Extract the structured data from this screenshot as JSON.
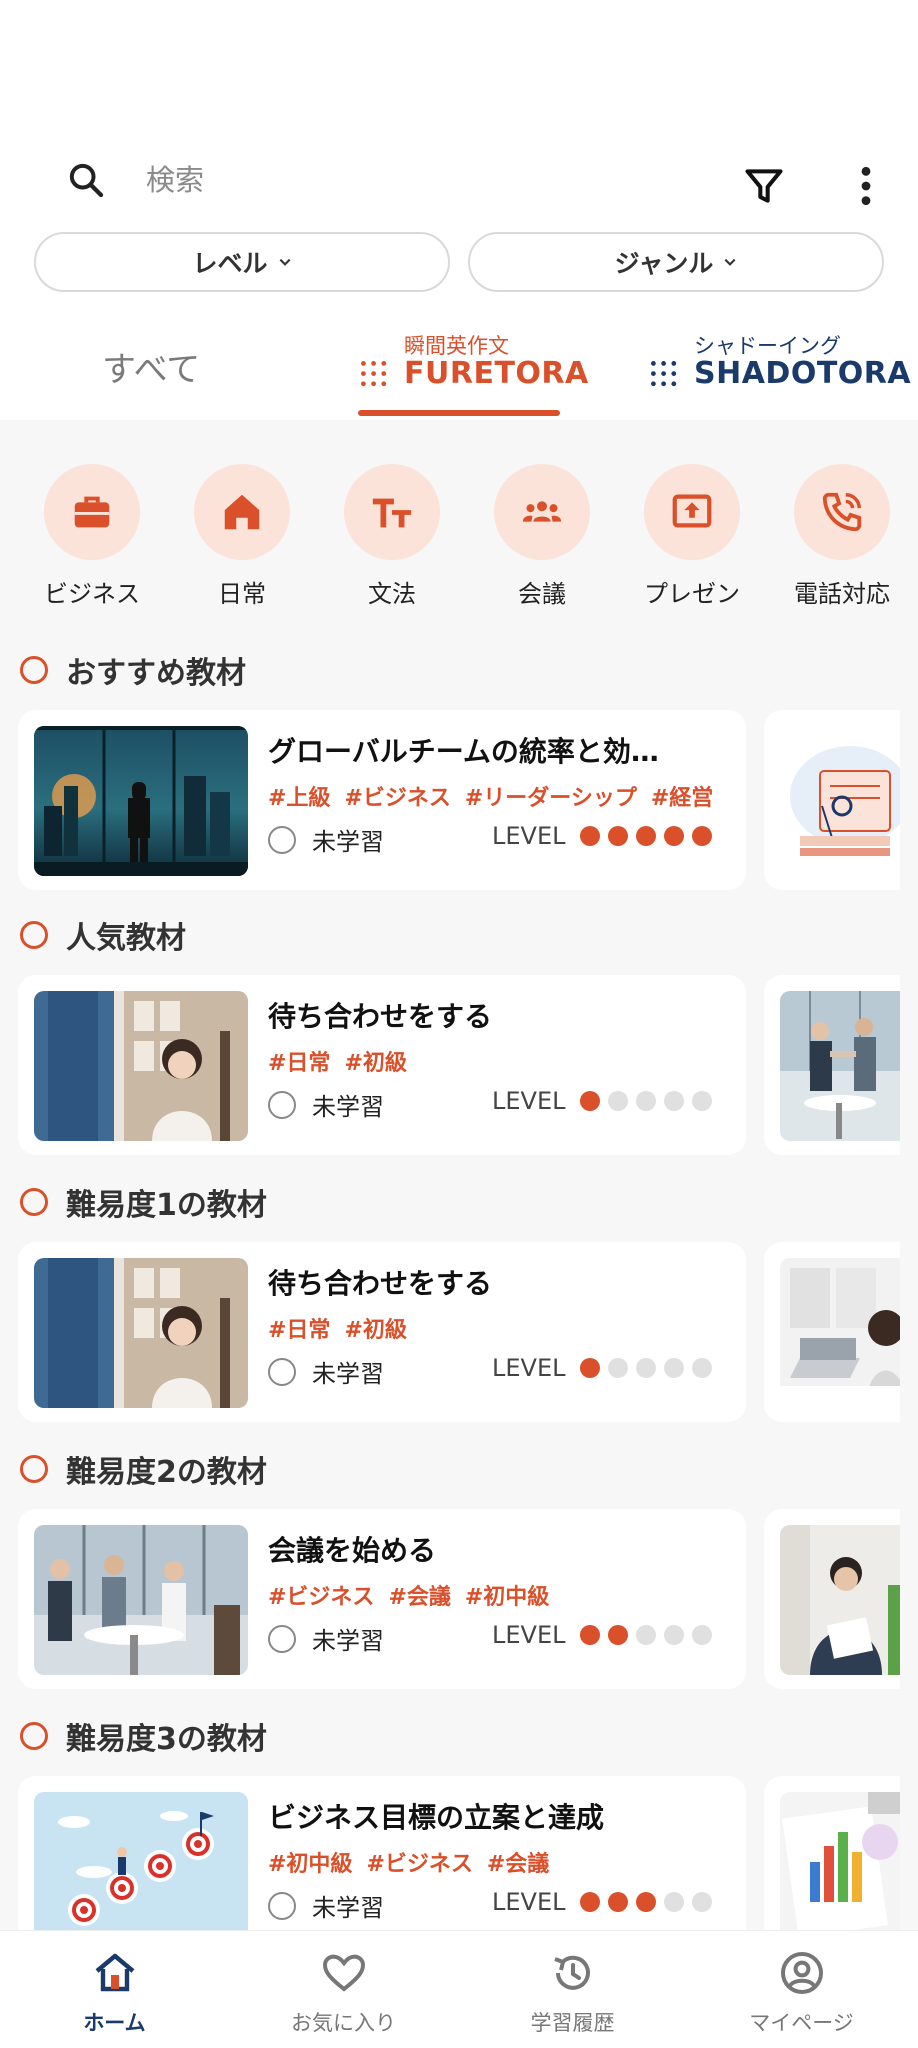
{
  "search": {
    "placeholder": "検索"
  },
  "filters": {
    "level_label": "レベル",
    "genre_label": "ジャンル"
  },
  "tabs": {
    "all_label": "すべて",
    "furetora": {
      "sub": "瞬間英作文",
      "main": "FURETORA"
    },
    "shadotora": {
      "sub": "シャドーイング",
      "main": "SHADOTORA"
    }
  },
  "categories": [
    {
      "label": "ビジネス",
      "icon": "briefcase-icon"
    },
    {
      "label": "日常",
      "icon": "home-icon"
    },
    {
      "label": "文法",
      "icon": "text-size-icon"
    },
    {
      "label": "会議",
      "icon": "group-icon"
    },
    {
      "label": "プレゼン",
      "icon": "presentation-icon"
    },
    {
      "label": "電話対応",
      "icon": "phone-icon"
    }
  ],
  "sections": [
    {
      "title": "おすすめ教材",
      "card": {
        "title": "グローバルチームの統率と効…",
        "tags": [
          "#上級",
          "#ビジネス",
          "#リーダーシップ",
          "#経営"
        ],
        "status": "未学習",
        "level_label": "LEVEL",
        "level": 5
      }
    },
    {
      "title": "人気教材",
      "card": {
        "title": "待ち合わせをする",
        "tags": [
          "#日常",
          "#初級"
        ],
        "status": "未学習",
        "level_label": "LEVEL",
        "level": 1
      }
    },
    {
      "title": "難易度1の教材",
      "card": {
        "title": "待ち合わせをする",
        "tags": [
          "#日常",
          "#初級"
        ],
        "status": "未学習",
        "level_label": "LEVEL",
        "level": 1
      }
    },
    {
      "title": "難易度2の教材",
      "card": {
        "title": "会議を始める",
        "tags": [
          "#ビジネス",
          "#会議",
          "#初中級"
        ],
        "status": "未学習",
        "level_label": "LEVEL",
        "level": 2
      }
    },
    {
      "title": "難易度3の教材",
      "card": {
        "title": "ビジネス目標の立案と達成",
        "tags": [
          "#初中級",
          "#ビジネス",
          "#会議"
        ],
        "status": "未学習",
        "level_label": "LEVEL",
        "level": 3
      }
    }
  ],
  "bottom_nav": [
    {
      "label": "ホーム",
      "icon": "home-icon",
      "active": true
    },
    {
      "label": "お気に入り",
      "icon": "heart-icon",
      "active": false
    },
    {
      "label": "学習履歴",
      "icon": "history-icon",
      "active": false
    },
    {
      "label": "マイページ",
      "icon": "user-icon",
      "active": false
    }
  ],
  "colors": {
    "accent": "#d9502a",
    "navy": "#1a3a6b",
    "category_bg": "#fbe3d9"
  }
}
